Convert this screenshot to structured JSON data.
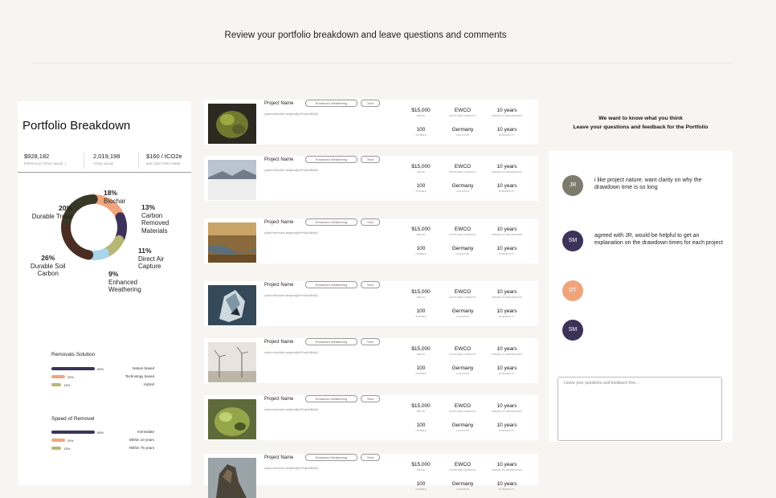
{
  "header": {
    "title": "Review your portfolio breakdown and leave questions and comments"
  },
  "portfolio": {
    "title": "Portfolio Breakdown",
    "stats": [
      {
        "value": "$928,182",
        "label": "PORTFOLIO TOTAL VALUE ⓘ"
      },
      {
        "value": "2,019,198",
        "label": "TOTAL VALUE"
      },
      {
        "value": "$160 / tCO2e",
        "label": "AVG COST PER TONNE"
      }
    ],
    "donut": [
      {
        "pct": "18%",
        "label": "Biochar",
        "color": "#f0a47c",
        "share": 18
      },
      {
        "pct": "13%",
        "label": "Carbon Removed Materials",
        "label_lines": [
          "Carbon",
          "Removed",
          "Materials"
        ],
        "color": "#3c335a",
        "share": 13
      },
      {
        "pct": "11%",
        "label": "Direct Air Capture",
        "label_lines": [
          "Direct Air",
          "Capture"
        ],
        "color": "#b7b775",
        "share": 11
      },
      {
        "pct": "9%",
        "label": "Enhanced Weathering",
        "label_lines": [
          "Enhanced",
          "Weathering"
        ],
        "color": "#a8d5ea",
        "share": 9
      },
      {
        "pct": "26%",
        "label": "Durable Soil Carbon",
        "label_lines": [
          "Durable Soil",
          "Carbon"
        ],
        "color": "#4a2e24",
        "share": 26
      },
      {
        "pct": "20%",
        "label": "Durable Trees",
        "color": "#373826",
        "share": 20
      }
    ],
    "removals": {
      "title": "Removals Solution",
      "rows": [
        {
          "pct": "65%",
          "name": "Nature based",
          "value": 65,
          "color": "#3c335a"
        },
        {
          "pct": "20%",
          "name": "Technology based",
          "value": 20,
          "color": "#f0a47c"
        },
        {
          "pct": "15%",
          "name": "Hybrid",
          "value": 15,
          "color": "#b7b775"
        }
      ]
    },
    "speed": {
      "title": "Speed of Removel",
      "rows": [
        {
          "pct": "65%",
          "name": "Immediate",
          "value": 65,
          "color": "#3c335a"
        },
        {
          "pct": "20%",
          "name": "Within 10 years",
          "value": 20,
          "color": "#f0a47c"
        },
        {
          "pct": "15%",
          "name": "Within 75 years",
          "value": 15,
          "color": "#b7b775"
        }
      ]
    }
  },
  "projects": [
    {
      "name": "Project Name",
      "tags": [
        "Enhanced Weathering",
        "Tech"
      ],
      "desc": "project description assigned/[perProjectIdBuild]",
      "price": "$15,000",
      "price_label": "PRICE",
      "supplier": "EWCO",
      "supplier_label": "SUPPLIER COMPANY",
      "speed": "10 years",
      "speed_label": "SPEED OF DRAWDOWN",
      "tonnes": "100",
      "tonnes_label": "TONNES",
      "location": "Germany",
      "location_label": "LOCATION",
      "durability": "10 years",
      "durability_label": "DURABILITY",
      "image": "moss-rock"
    },
    {
      "name": "Project Name",
      "tags": [
        "Enhanced Weathering",
        "Tech"
      ],
      "desc": "project description assigned/[perProjectIdBuild]",
      "price": "$15,000",
      "price_label": "PRICE",
      "supplier": "EWCO",
      "supplier_label": "SUPPLIER COMPANY",
      "speed": "10 years",
      "speed_label": "SPEED OF DRAWDOWN",
      "tonnes": "100",
      "tonnes_label": "TONNES",
      "location": "Germany",
      "location_label": "LOCATION",
      "durability": "10 years",
      "durability_label": "DURABILITY",
      "image": "snow-landscape"
    },
    {
      "name": "Project Name",
      "tags": [
        "Enhanced Weathering",
        "Tech"
      ],
      "desc": "project description assigned/[perProjectIdBuild]",
      "price": "$15,000",
      "price_label": "PRICE",
      "supplier": "EWCO",
      "supplier_label": "SUPPLIER COMPANY",
      "speed": "10 years",
      "speed_label": "SPEED OF DRAWDOWN",
      "tonnes": "100",
      "tonnes_label": "TONNES",
      "location": "Germany",
      "location_label": "LOCATION",
      "durability": "10 years",
      "durability_label": "DURABILITY",
      "image": "wetland"
    },
    {
      "name": "Project Name",
      "tags": [
        "Enhanced Weathering",
        "Tech"
      ],
      "desc": "project description assigned/[perProjectIdBuild]",
      "price": "$15,000",
      "price_label": "PRICE",
      "supplier": "EWCO",
      "supplier_label": "SUPPLIER COMPANY",
      "speed": "10 years",
      "speed_label": "SPEED OF DRAWDOWN",
      "tonnes": "100",
      "tonnes_label": "TONNES",
      "location": "Germany",
      "location_label": "LOCATION",
      "durability": "10 years",
      "durability_label": "DURABILITY",
      "image": "ice-rock"
    },
    {
      "name": "Project Name",
      "tags": [
        "Enhanced Weathering",
        "Tech"
      ],
      "desc": "project description assigned/[perProjectIdBuild]",
      "price": "$15,000",
      "price_label": "PRICE",
      "supplier": "EWCO",
      "supplier_label": "SUPPLIER COMPANY",
      "speed": "10 years",
      "speed_label": "SPEED OF DRAWDOWN",
      "tonnes": "100",
      "tonnes_label": "TONNES",
      "location": "Germany",
      "location_label": "LOCATION",
      "durability": "10 years",
      "durability_label": "DURABILITY",
      "image": "wind-turbines"
    },
    {
      "name": "Project Name",
      "tags": [
        "Enhanced Weathering",
        "Tech"
      ],
      "desc": "project description assigned/[perProjectIdBuild]",
      "price": "$15,000",
      "price_label": "PRICE",
      "supplier": "EWCO",
      "supplier_label": "SUPPLIER COMPANY",
      "speed": "10 years",
      "speed_label": "SPEED OF DRAWDOWN",
      "tonnes": "100",
      "tonnes_label": "TONNES",
      "location": "Germany",
      "location_label": "LOCATION",
      "durability": "10 years",
      "durability_label": "DURABILITY",
      "image": "green-mineral"
    },
    {
      "name": "Project Name",
      "tags": [
        "Enhanced Weathering",
        "Tech"
      ],
      "desc": "project description assigned/[perProjectIdBuild]",
      "price": "$15,000",
      "price_label": "PRICE",
      "supplier": "EWCO",
      "supplier_label": "SUPPLIER COMPANY",
      "speed": "10 years",
      "speed_label": "SPEED OF DRAWDOWN",
      "tonnes": "100",
      "tonnes_label": "TONNES",
      "location": "Germany",
      "location_label": "LOCATION",
      "durability": "10 years",
      "durability_label": "DURABILITY",
      "image": "cliff"
    }
  ],
  "feedback": {
    "heading1": "We want to know what you think",
    "heading2": "Leave your questions and feedback for the Portfolio",
    "comments": [
      {
        "initials": "JR",
        "color": "#7c7c6e",
        "text": "i like project nature. want clarity on why the drawdown time is so long"
      },
      {
        "initials": "SM",
        "color": "#3c335a",
        "text": "agreed with JR, would be helpful to get an explanation on the drawdown times for each project"
      },
      {
        "initials": "DT",
        "color": "#f0a47c",
        "text": ""
      },
      {
        "initials": "SM",
        "color": "#3c335a",
        "text": ""
      }
    ],
    "placeholder": "Leave your questions and feedback free..."
  }
}
